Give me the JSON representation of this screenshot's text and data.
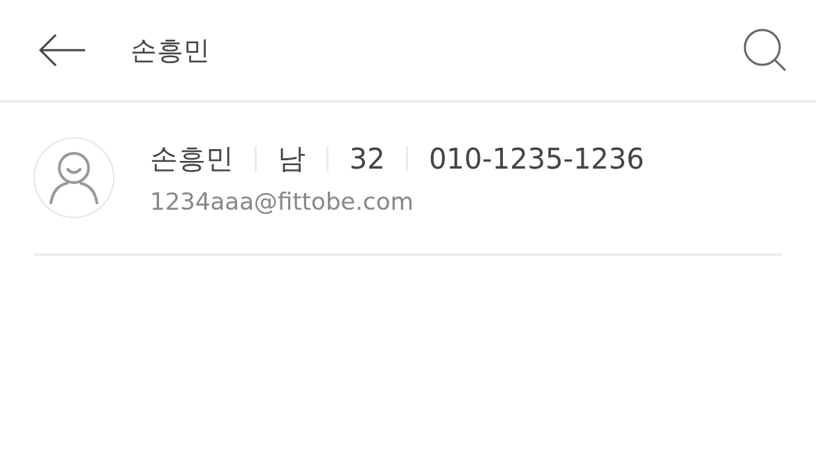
{
  "header": {
    "title": "손흥민"
  },
  "results": [
    {
      "name": "손흥민",
      "gender": "남",
      "age": "32",
      "phone": "010-1235-1236",
      "email": "1234aaa@fittobe.com"
    }
  ]
}
